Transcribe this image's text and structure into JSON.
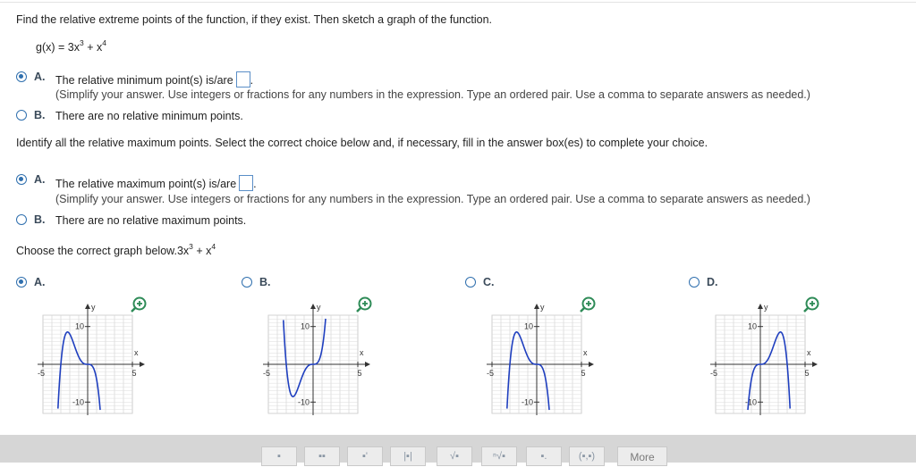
{
  "question": {
    "prompt": "Find the relative extreme points of the function, if they exist. Then sketch a graph of the function.",
    "function_base": "g(x) = 3x",
    "exp1": "3",
    "plus_x": " + x",
    "exp2": "4"
  },
  "min_part": {
    "option_a_letter": "A.",
    "option_a_text": "The relative minimum point(s) is/are",
    "option_a_hint": "(Simplify your answer. Use integers or fractions for any numbers in the expression. Type an ordered pair. Use a comma to separate answers as needed.)",
    "option_b_letter": "B.",
    "option_b_text": "There are no relative minimum points.",
    "selected": "A"
  },
  "max_part": {
    "instruction": "Identify all the relative maximum points. Select the correct choice below and, if necessary, fill in the answer box(es) to complete your choice.",
    "option_a_letter": "A.",
    "option_a_text": "The relative maximum point(s) is/are",
    "option_a_hint": "(Simplify your answer. Use integers or fractions for any numbers in the expression. Type an ordered pair. Use a comma to separate answers as needed.)",
    "option_b_letter": "B.",
    "option_b_text": "There are no relative maximum points.",
    "selected": "A"
  },
  "graph_part": {
    "prompt_base": "Choose the correct graph below.3x",
    "exp1": "3",
    "plus_x": " + x",
    "exp2": "4",
    "selected": "A",
    "options": [
      {
        "letter": "A.",
        "y_label": "y",
        "x_label": "x",
        "y_max": "10",
        "y_min": "-10",
        "x_min": "-5",
        "x_max": "5"
      },
      {
        "letter": "B.",
        "y_label": "y",
        "x_label": "x",
        "y_max": "10",
        "y_min": "-10",
        "x_min": "-5",
        "x_max": "5"
      },
      {
        "letter": "C.",
        "y_label": "y",
        "x_label": "x",
        "y_max": "10",
        "y_min": "-10",
        "x_min": "-5",
        "x_max": "5"
      },
      {
        "letter": "D.",
        "y_label": "y",
        "x_label": "x",
        "y_max": "10",
        "y_min": "-10",
        "x_min": "-5",
        "x_max": "5"
      }
    ]
  },
  "toolbar": {
    "more_label": "More",
    "buttons": [
      "fraction-icon",
      "mixed-number-icon",
      "exponent-icon",
      "absolute-value-icon",
      "sqrt-icon",
      "nth-root-icon",
      "decimal-icon",
      "ordered-pair-icon"
    ],
    "glyphs": [
      "▪",
      "▪▪",
      "▪'",
      "|▪|",
      "√▪",
      "ⁿ√▪",
      "▪.",
      "(▪,▪)"
    ]
  },
  "colors": {
    "accent": "#2f6fae",
    "curve": "#1f3fbf",
    "zoom": "#2e8b57",
    "toolbar": "#d6d6d6"
  }
}
